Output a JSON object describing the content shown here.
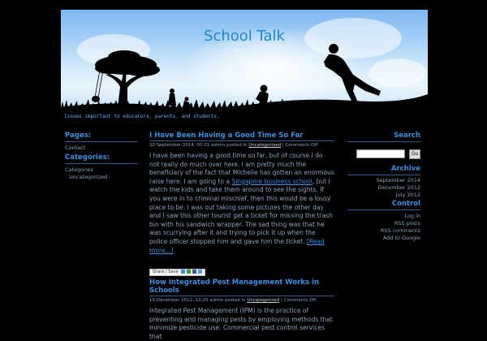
{
  "site": {
    "title": "School Talk",
    "tagline": "Issues important to educators, parents, and students."
  },
  "left_sidebar": {
    "pages_heading": "Pages:",
    "pages": [
      "Contact"
    ],
    "categories_heading": "Categories:",
    "categories_title": "Categories",
    "categories": [
      "Uncategorized"
    ]
  },
  "right_sidebar": {
    "search_heading": "Search",
    "search_button": "Go",
    "search_value": "",
    "archive_heading": "Archive",
    "archives": [
      "September 2014",
      "December 2012",
      "July 2012"
    ],
    "control_heading": "Control",
    "control_links": [
      "Log in",
      "RSS posts",
      "RSS comments",
      "Add to Google"
    ]
  },
  "posts": [
    {
      "title": "I Have Been Having a Good Time So Far",
      "meta_prefix": "20 September 2014, 00:31 admin posted in ",
      "category": "Uncategorized",
      "comments": " | Comments Off",
      "body_1": "I have been having a good time so far, but of course I do not really do much over here. I am pretty much the beneficiary of the fact that Michelle has gotten an enormous raise here. I am going to a ",
      "body_link": "Singapore business school",
      "body_2": ", but I watch the kids and take them around to see the sights. If you were in to criminal mischief, then this would be a lousy place to be. I was out taking some pictures the other day and I saw this other tourist get a ticket for missing the trash bin with his sandwich wrapper. The sad thing was that he was scurrying after it and trying to pick it up when the police officer stopped him and gave him the ticket. ",
      "read_more": "[Read more...]",
      "share_label": "Share / Save"
    },
    {
      "title": "How Integrated Pest Management Works in Schools",
      "meta_prefix": "19 December 2012, 12:20 admin posted in ",
      "category": "Uncategorized",
      "comments": " | Comments Off",
      "body": "Integrated Pest Management (IPM) is the practice of preventing and managing pests by employing methods that minimize pesticide use. Commercial pest control services that"
    }
  ]
}
